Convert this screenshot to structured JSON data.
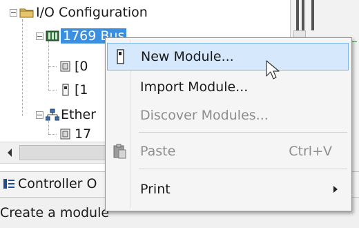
{
  "tree": {
    "root_label": "I/O Configuration",
    "bus_label": "1769 Bus",
    "child1_label": "[0",
    "child2_label": "[1",
    "ether_label": "Ether",
    "ether_child_label": "17"
  },
  "context_menu": {
    "items": [
      {
        "label": "New Module...",
        "icon": "module-chip-icon"
      },
      {
        "label": "Import Module..."
      },
      {
        "label": "Discover Modules...",
        "disabled": true
      },
      {
        "label": "Paste",
        "shortcut": "Ctrl+V",
        "icon": "paste-clipboard-icon",
        "disabled": true
      },
      {
        "label": "Print"
      }
    ]
  },
  "bottom_tab": {
    "label": "Controller O"
  },
  "status_bar": {
    "text": "Create a module"
  },
  "colors": {
    "selection": "#3b8fe0",
    "menu_hover": "#d6e8fb",
    "menu_hover_border": "#7ab2ea",
    "disabled_text": "#8d8d8d",
    "folder": "#e8c66a"
  }
}
